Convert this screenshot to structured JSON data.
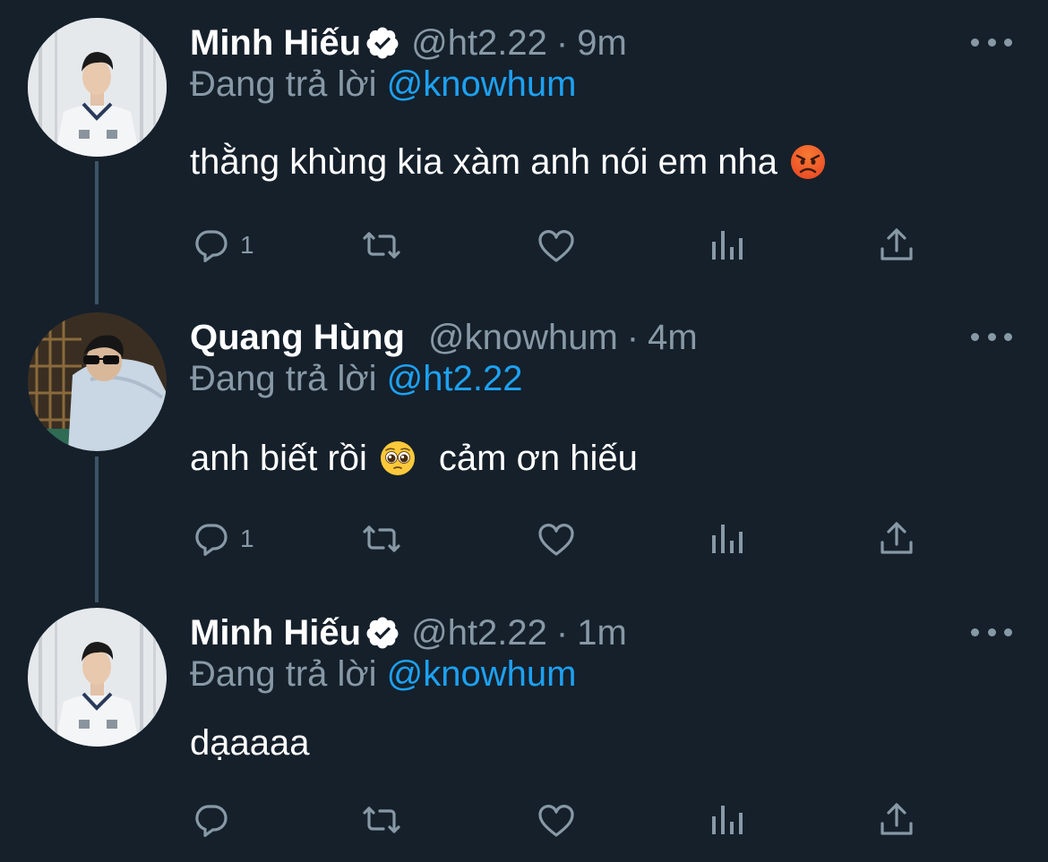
{
  "tweets": [
    {
      "name": "Minh Hiếu",
      "verified": true,
      "handle": "@ht2.22",
      "dot": "·",
      "time": "9m",
      "reply_prefix": "Đang trả lời",
      "reply_mention": "@knowhum",
      "text_before_emoji": "thằng khùng kia xàm anh nói em nha",
      "emoji": "angry-face-emoji",
      "text_after_emoji": "",
      "reply_count": "1"
    },
    {
      "name": "Quang Hùng",
      "verified": false,
      "handle": "@knowhum",
      "dot": "·",
      "time": "4m",
      "reply_prefix": "Đang trả lời",
      "reply_mention": "@ht2.22",
      "text_before_emoji": "anh biết rồi",
      "emoji": "pleading-face-emoji",
      "text_after_emoji": "cảm ơn hiếu",
      "reply_count": "1"
    },
    {
      "name": "Minh Hiếu",
      "verified": true,
      "handle": "@ht2.22",
      "dot": "·",
      "time": "1m",
      "reply_prefix": "Đang trả lời",
      "reply_mention": "@knowhum",
      "text_before_emoji": "dạaaaa",
      "emoji": "",
      "text_after_emoji": "",
      "reply_count": ""
    }
  ],
  "colors": {
    "background": "#15202b",
    "secondary_text": "#8899a6",
    "mention": "#1da1f2",
    "thread_line": "#3d5466"
  }
}
